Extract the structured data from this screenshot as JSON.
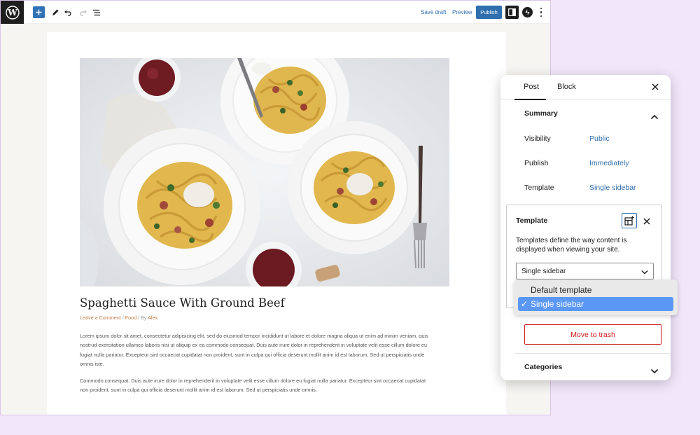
{
  "toolbar": {
    "save_draft": "Save draft",
    "preview": "Preview",
    "publish": "Publish"
  },
  "post": {
    "title": "Spaghetti Sauce With Ground Beef",
    "meta_comment": "Leave a Comment",
    "meta_sep1": " / ",
    "meta_category": "Food",
    "meta_by": " / By ",
    "meta_author": "Alex",
    "paragraph1_lines": [
      "Lorem ipsum dolor sit amet, consectetur adipisicing elit, sed do eiusmod tempor incididunt ut labore et dolore magna aliqua ut enim ad minim veniam, quis",
      "nostrud exercitation ullamco laboris nisi ut aliquip ex ea commodo consequat. Duis aute irure dolor in reprehenderit in voluptate velit esse cillum dolore eu",
      "fugiat nulla pariatur. Excepteur sint occaecat cupidatat non proident, sunt in culpa qui officia deserunt mollit anim id est laborum. Sed ut perspiciatis unde",
      "omnis iste."
    ],
    "paragraph2_lines": [
      "Commodo consequat. Duis aute irure dolor in reprehenderit in voluptate velit esse cillum dolore eu fugiat nulla pariatur. Excepteur sint occaecat cupidatat",
      "non proident, sunt in culpa qui officia deserunt mollit anim id est laborum. Sed ut perspiciatis unde omnis."
    ]
  },
  "panel": {
    "tab_post": "Post",
    "tab_block": "Block",
    "summary_title": "Summary",
    "visibility_label": "Visibility",
    "visibility_value": "Public",
    "publish_label": "Publish",
    "publish_value": "Immediately",
    "template_label": "Template",
    "template_value": "Single sidebar",
    "trash_label": "Move to trash",
    "categories_title": "Categories"
  },
  "popover": {
    "title": "Template",
    "description": "Templates define the way content is displayed when viewing your site.",
    "selected": "Single sidebar",
    "options": [
      "Default template",
      "Single sidebar"
    ]
  },
  "colors": {
    "accent": "#2f6fae",
    "danger": "#cc1818",
    "highlight": "#5b98f5",
    "background": "#f2e6fb"
  }
}
